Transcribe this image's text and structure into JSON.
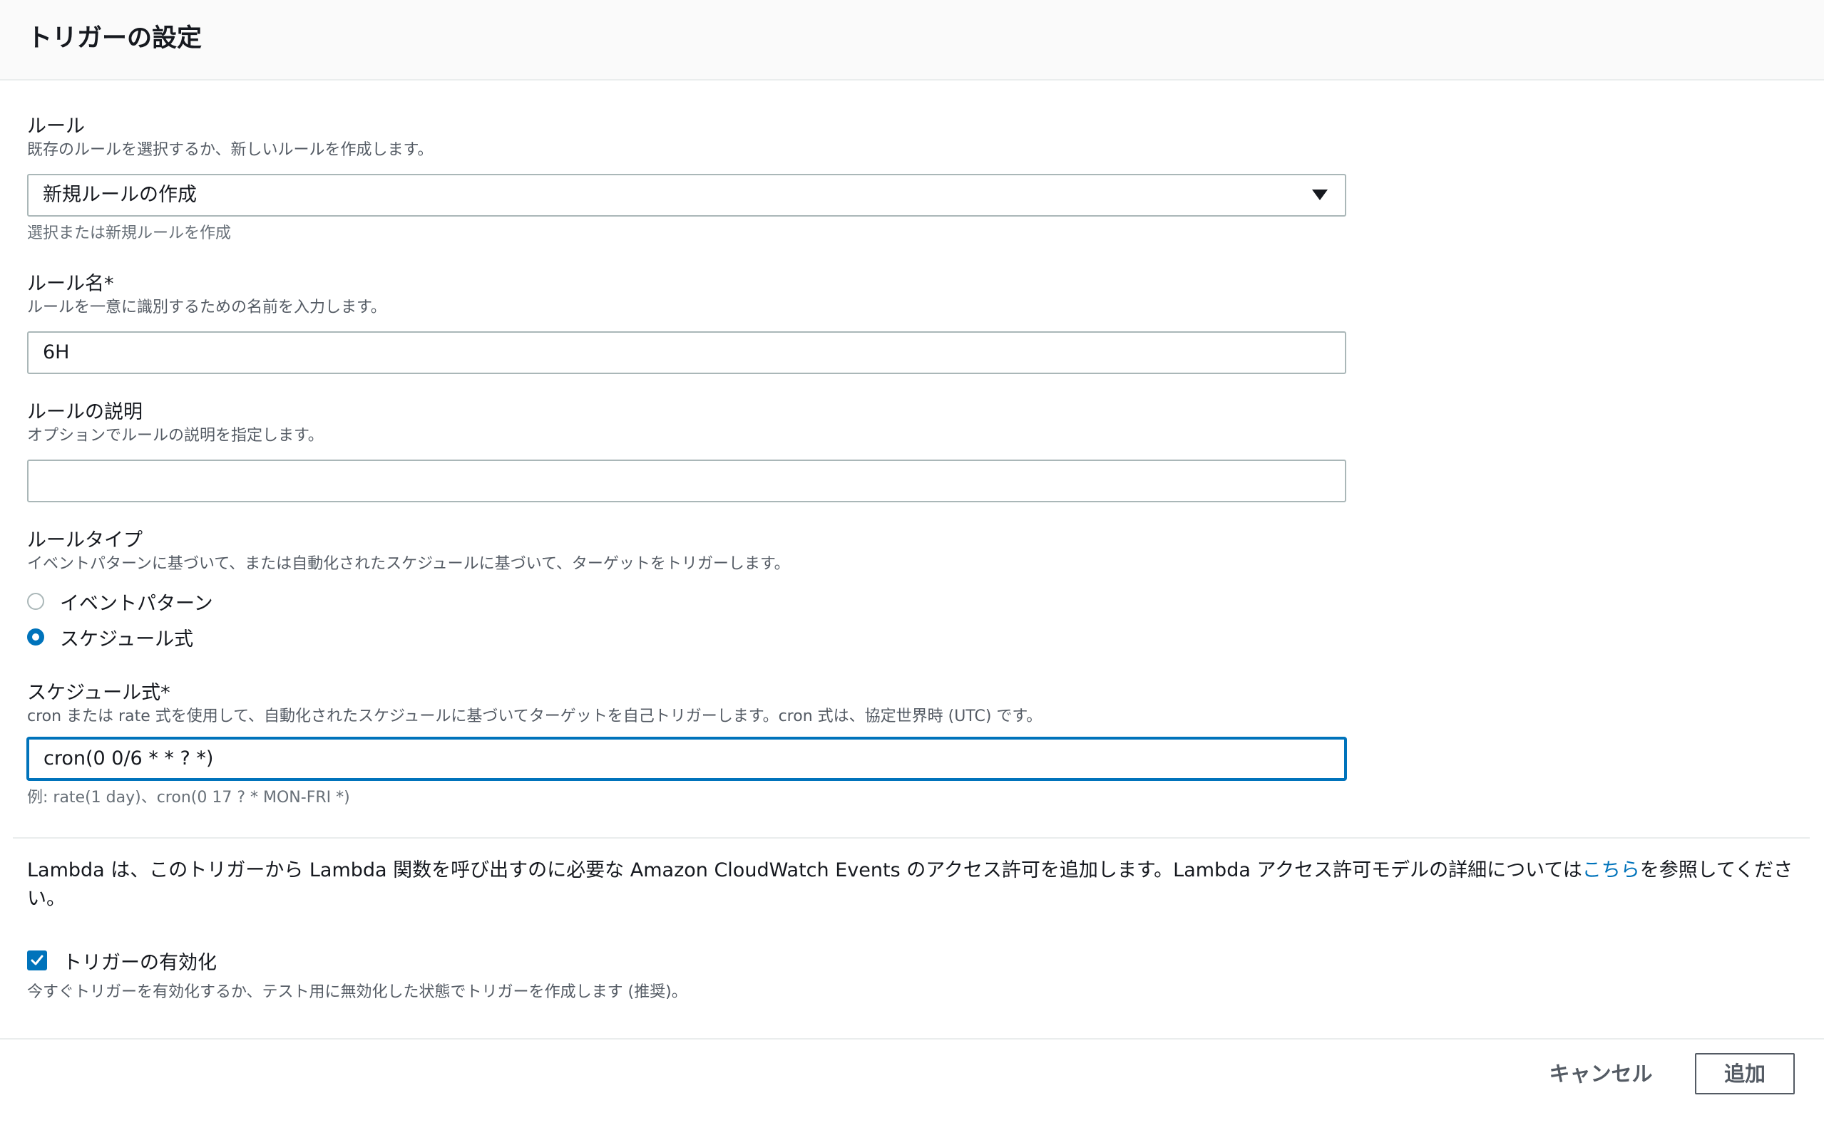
{
  "header": {
    "title": "トリガーの設定"
  },
  "rule": {
    "label": "ルール",
    "description": "既存のルールを選択するか、新しいルールを作成します。",
    "selected": "新規ルールの作成",
    "constraint": "選択または新規ルールを作成"
  },
  "rule_name": {
    "label": "ルール名*",
    "description": "ルールを一意に識別するための名前を入力します。",
    "value": "6H"
  },
  "rule_description": {
    "label": "ルールの説明",
    "description": "オプションでルールの説明を指定します。",
    "value": ""
  },
  "rule_type": {
    "label": "ルールタイプ",
    "description": "イベントパターンに基づいて、または自動化されたスケジュールに基づいて、ターゲットをトリガーします。",
    "options": [
      {
        "label": "イベントパターン",
        "checked": false
      },
      {
        "label": "スケジュール式",
        "checked": true
      }
    ]
  },
  "schedule_expression": {
    "label": "スケジュール式*",
    "description": "cron または rate 式を使用して、自動化されたスケジュールに基づいてターゲットを自己トリガーします。cron 式は、協定世界時 (UTC) です。",
    "value": "cron(0 0/6 * * ? *)",
    "example": "例: rate(1 day)、cron(0 17 ? * MON-FRI *)"
  },
  "notice": {
    "before_link": "Lambda は、このトリガーから Lambda 関数を呼び出すのに必要な Amazon CloudWatch Events のアクセス許可を追加します。Lambda アクセス許可モデルの詳細については",
    "link": "こちら",
    "after_link": "を参照してください。"
  },
  "enable_trigger": {
    "label": "トリガーの有効化",
    "checked": true,
    "description": "今すぐトリガーを有効化するか、テスト用に無効化した状態でトリガーを作成します (推奨)。"
  },
  "footer": {
    "cancel_label": "キャンセル",
    "add_label": "追加"
  },
  "colors": {
    "accent": "#0073bb",
    "text": "#16191f",
    "secondary_text": "#545b64"
  }
}
